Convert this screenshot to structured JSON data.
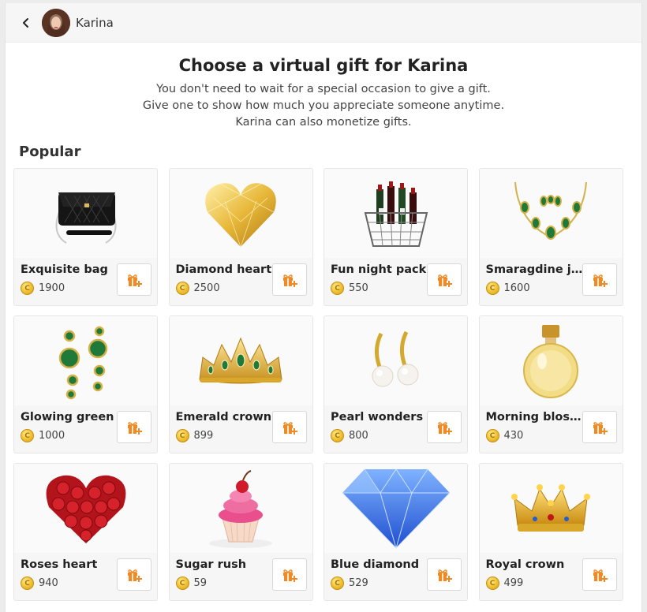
{
  "header": {
    "name": "Karina"
  },
  "intro": {
    "title": "Choose a virtual gift for Karina",
    "lines": [
      "You don't need to wait for a special occasion to give a gift.",
      "Give one to show how much you appreciate someone anytime.",
      "Karina can also monetize gifts."
    ]
  },
  "section": {
    "title": "Popular"
  },
  "colors": {
    "coin": "#f2c63a",
    "gift_icon": "#f08a24",
    "card_bg": "#fafafa"
  },
  "gifts": [
    {
      "name": "Exquisite bag",
      "price": "1900",
      "icon": "bag"
    },
    {
      "name": "Diamond heart",
      "price": "2500",
      "icon": "gold-heart"
    },
    {
      "name": "Fun night pack",
      "price": "550",
      "icon": "wine-basket"
    },
    {
      "name": "Smaragdine jewelry",
      "display_name": "Smaragdine je...",
      "price": "1600",
      "icon": "necklace"
    },
    {
      "name": "Glowing green",
      "price": "1000",
      "icon": "emerald-earrings"
    },
    {
      "name": "Emerald crown",
      "price": "899",
      "icon": "tiara"
    },
    {
      "name": "Pearl wonders",
      "price": "800",
      "icon": "pearl-earrings"
    },
    {
      "name": "Morning blossom",
      "price": "430",
      "icon": "perfume"
    },
    {
      "name": "Roses heart",
      "price": "940",
      "icon": "roses-heart"
    },
    {
      "name": "Sugar rush",
      "price": "59",
      "icon": "cupcake"
    },
    {
      "name": "Blue diamond",
      "price": "529",
      "icon": "diamond"
    },
    {
      "name": "Royal crown",
      "price": "499",
      "icon": "crown"
    }
  ]
}
